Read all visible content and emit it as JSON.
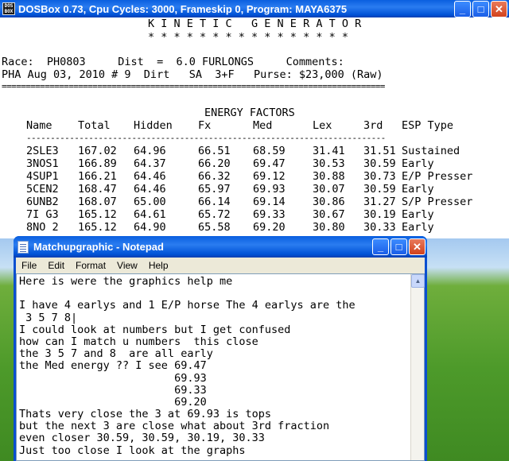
{
  "dosbox": {
    "title": "DOSBox 0.73, Cpu Cycles:     3000, Frameskip  0, Program: MAYA6375",
    "icon_label": "DOS BOX",
    "screen": {
      "header_title": "K I N E T I C   G E N E R A T O R",
      "stars": "* * * * * * * * * * * * * * * *",
      "race_line": "Race:  PH0803     Dist  =  6.0 FURLONGS     Comments:",
      "info_line": "PHA Aug 03, 2010 # 9  Dirt   SA  3+F   Purse: $23,000 (Raw)",
      "separator": "================================================================================",
      "energy_title": "ENERGY FACTORS",
      "columns": [
        "Name",
        "Total",
        "Hidden",
        "Fx",
        "Med",
        "Lex",
        "3rd",
        "ESP Type"
      ],
      "underline": "---------------------------------------------------------------------------",
      "rows": [
        [
          "2SLE3",
          "167.02",
          "64.96",
          "66.51",
          "68.59",
          "31.41",
          "31.51",
          "Sustained"
        ],
        [
          "3NOS1",
          "166.89",
          "64.37",
          "66.20",
          "69.47",
          "30.53",
          "30.59",
          "Early"
        ],
        [
          "4SUP1",
          "166.21",
          "64.46",
          "66.32",
          "69.12",
          "30.88",
          "30.73",
          "E/P Presser"
        ],
        [
          "5CEN2",
          "168.47",
          "64.46",
          "65.97",
          "69.93",
          "30.07",
          "30.59",
          "Early"
        ],
        [
          "6UNB2",
          "168.07",
          "65.00",
          "66.14",
          "69.14",
          "30.86",
          "31.27",
          "S/P Presser"
        ],
        [
          "7I G3",
          "165.12",
          "64.61",
          "65.72",
          "69.33",
          "30.67",
          "30.19",
          "Early"
        ],
        [
          "8NO 2",
          "165.12",
          "64.90",
          "65.58",
          "69.20",
          "30.80",
          "30.33",
          "Early"
        ]
      ]
    }
  },
  "notepad": {
    "title": "Matchupgraphic - Notepad",
    "menu": [
      "File",
      "Edit",
      "Format",
      "View",
      "Help"
    ],
    "lines": [
      "Here is were the graphics help me",
      "",
      "I have 4 earlys and 1 E/P horse The 4 earlys are the",
      " 3 5 7 8|",
      "I could look at numbers but I get confused",
      "how can I match u numbers  this close",
      "the 3 5 7 and 8  are all early",
      "the Med energy ?? I see 69.47",
      "                        69.93",
      "                        69.33",
      "                        69.20",
      "Thats very close the 3 at 69.93 is tops",
      "but the next 3 are close what about 3rd fraction",
      "even closer 30.59, 30.59, 30.19, 30.33",
      "Just too close I look at the graphs"
    ]
  },
  "icons": {
    "minimize": "_",
    "maximize": "□",
    "close": "✕",
    "scroll_up": "▲"
  }
}
